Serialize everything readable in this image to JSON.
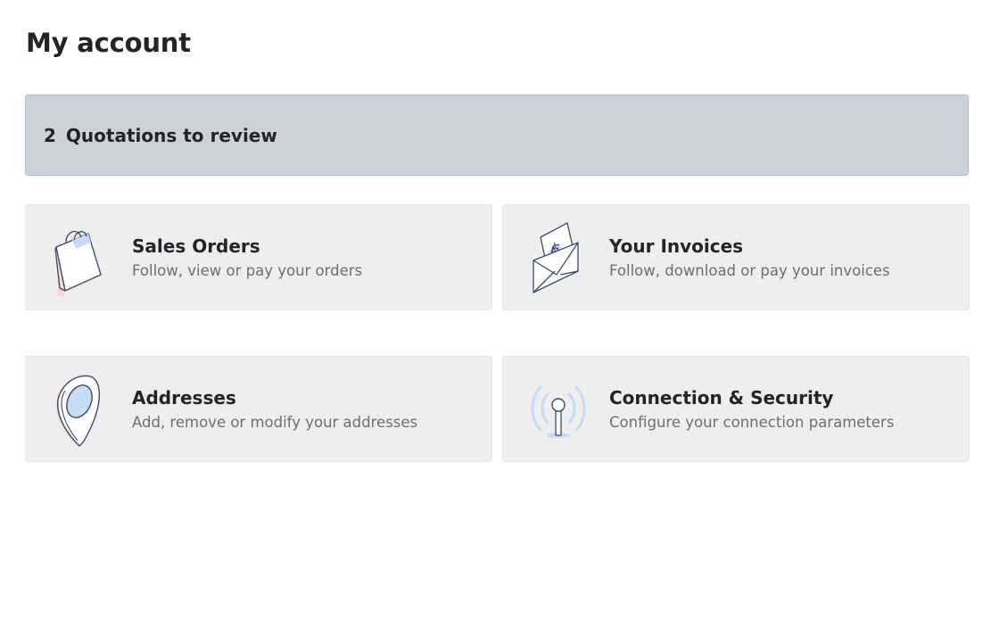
{
  "page": {
    "title": "My account"
  },
  "quotations": {
    "count": "2",
    "label": "Quotations to review"
  },
  "cards": [
    {
      "title": "Sales Orders",
      "subtitle": "Follow, view or pay your orders",
      "icon": "shopping-bag-icon"
    },
    {
      "title": "Your Invoices",
      "subtitle": "Follow, download or pay your invoices",
      "icon": "invoice-envelope-icon"
    },
    {
      "title": "Addresses",
      "subtitle": "Add, remove or modify your addresses",
      "icon": "map-pin-icon"
    },
    {
      "title": "Connection & Security",
      "subtitle": "Configure your connection parameters",
      "icon": "antenna-icon"
    }
  ],
  "colors": {
    "banner_bg": "#cbd2db",
    "card_bg": "#eeeeee",
    "icon_outline": "#3a4a6b",
    "icon_blue": "#c6dbf5",
    "icon_pink": "#fcd6cf"
  }
}
